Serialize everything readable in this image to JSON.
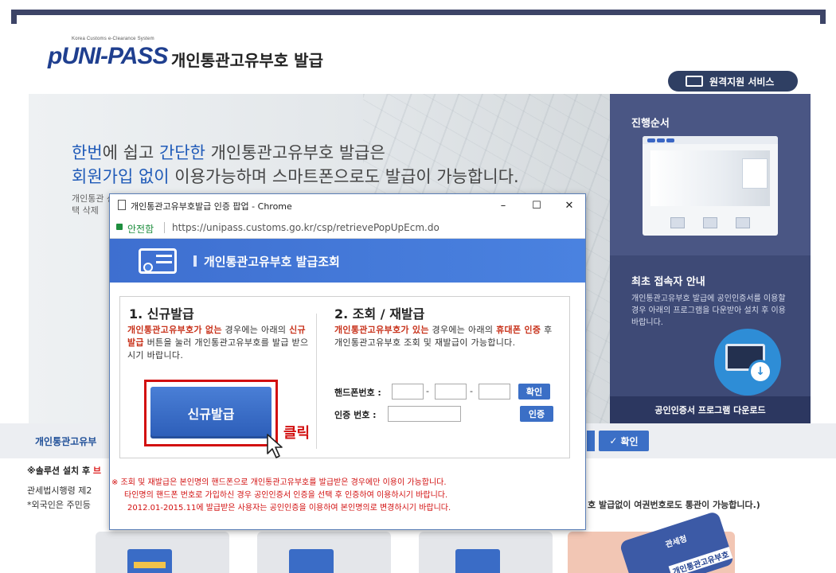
{
  "header": {
    "logo_tagline": "Korea Customs e-Clearance System",
    "logo_text": "pUNI-PASS",
    "page_title": "개인통관고유부호 발급",
    "remote_support_label": "원격지원 서비스"
  },
  "hero": {
    "line1_a": "한번",
    "line1_b": "에 쉽고 ",
    "line1_c": "간단한",
    "line1_d": " 개인통관고유부호 발급은",
    "line2_a": "회원가입 없이",
    "line2_b": " 이용가능하며 스마트폰으로도 발급이 가능합니다.",
    "sub_text": "개인통관 선택 삭제"
  },
  "side": {
    "progress_title": "진행순서",
    "first_access_title": "최초 접속자 안내",
    "first_access_note": "개인통관고유부호 발급에 공인인증서를 이용할 경우 아래의 프로그램을 다운받아 설치 후 이용 바랍니다.",
    "download_label": "공인인증서 프로그램 다운로드"
  },
  "band": {
    "tab_label": "개인통관고유부",
    "confirm_label": "확인"
  },
  "notes": {
    "line1_a": "※솔루션 설치 후 ",
    "line1_b": "브",
    "line2": "관세법시행령 제2",
    "line3": "*외국인은 주민등",
    "line3_right": "호 발급없이 여권번호로도 통관이 가능합니다.)"
  },
  "cards": {
    "card4_title": "관세청",
    "card4_sub": "개인통관고유부호"
  },
  "popup": {
    "window_title": "개인통관고유부호발급 인증 팝업 - Chrome",
    "minimize": "–",
    "maximize": "☐",
    "close": "✕",
    "secure_label": "안전함",
    "url": "https://unipass.customs.go.kr/csp/retrievePopUpEcm.do",
    "header_title": "개인통관고유부호 발급조회",
    "section1": {
      "title": "1. 신규발급",
      "desc_a": "개인통관고유부호가 없는",
      "desc_b": " 경우에는 아래의 ",
      "desc_c": "신규발급",
      "desc_d": " 버튼을 눌러 개인통관고유부호를 발급 받으시기 바랍니다.",
      "new_issue_button": "신규발급",
      "click_label": "클릭"
    },
    "section2": {
      "title": "2. 조회 / 재발급",
      "desc_a": "개인통관고유부호가 있는",
      "desc_b": " 경우에는 아래의 ",
      "desc_c": "휴대폰 인증",
      "desc_d": " 후 개인통관고유부호 조회 및 재발급이 가능합니다.",
      "phone_label": "핸드폰번호 :",
      "phone_1": "",
      "phone_2": "",
      "phone_3": "",
      "dash": "-",
      "confirm_button": "확인",
      "auth_label": "인증  번호 :",
      "auth_value": "",
      "auth_button": "인증"
    },
    "warning_1": "※ 조회 및 재발급은 본인명의 핸드폰으로 개인통관고유부호를 발급받은 경우에만 이용이 가능합니다.",
    "warning_2": "타인명의 핸드폰 번호로 가입하신 경우 공인인증서 인증을 선택 후 인증하여 이용하시기 바랍니다.",
    "warning_3": "2012.01-2015.11에 발급받은 사용자는 공인인증을 이용하여 본인명의로 변경하시기 바랍니다."
  },
  "colors": {
    "brand_navy": "#3d4467",
    "accent_blue": "#3b6fc6",
    "alert_red": "#d21010"
  }
}
